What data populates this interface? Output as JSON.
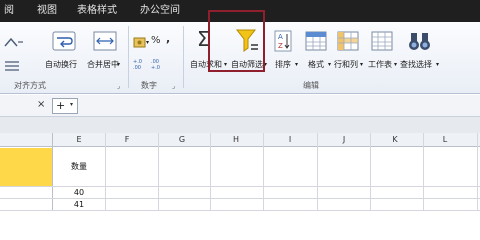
{
  "tabs": [
    "阅",
    "视图",
    "表格样式",
    "办公空间"
  ],
  "ribbon": {
    "wrap_text": "自动换行",
    "merge_center": "合并居中",
    "percent_symbol": "%",
    "comma_symbol": ",",
    "increase_decimal": "+.0 .00",
    "decrease_decimal": ".00 +.0",
    "autosum": "自动求和",
    "autofilter": "自动筛选",
    "sort": "排序",
    "format": "格式",
    "rows_cols": "行和列",
    "worksheet": "工作表",
    "find_select": "查找选择",
    "group_alignment": "对齐方式",
    "group_number": "数字",
    "group_editing": "编辑"
  },
  "sheet_tabs": {
    "close": "×",
    "add": "+"
  },
  "columns": [
    "E",
    "F",
    "G",
    "H",
    "I",
    "J",
    "K",
    "L"
  ],
  "cells": {
    "header": "数量",
    "r1": "40",
    "r2": "41"
  },
  "colors": {
    "highlight_box": "#8f1f2c",
    "selected_fill": "#ffd84a",
    "tab_bar": "#1f1f1f"
  }
}
